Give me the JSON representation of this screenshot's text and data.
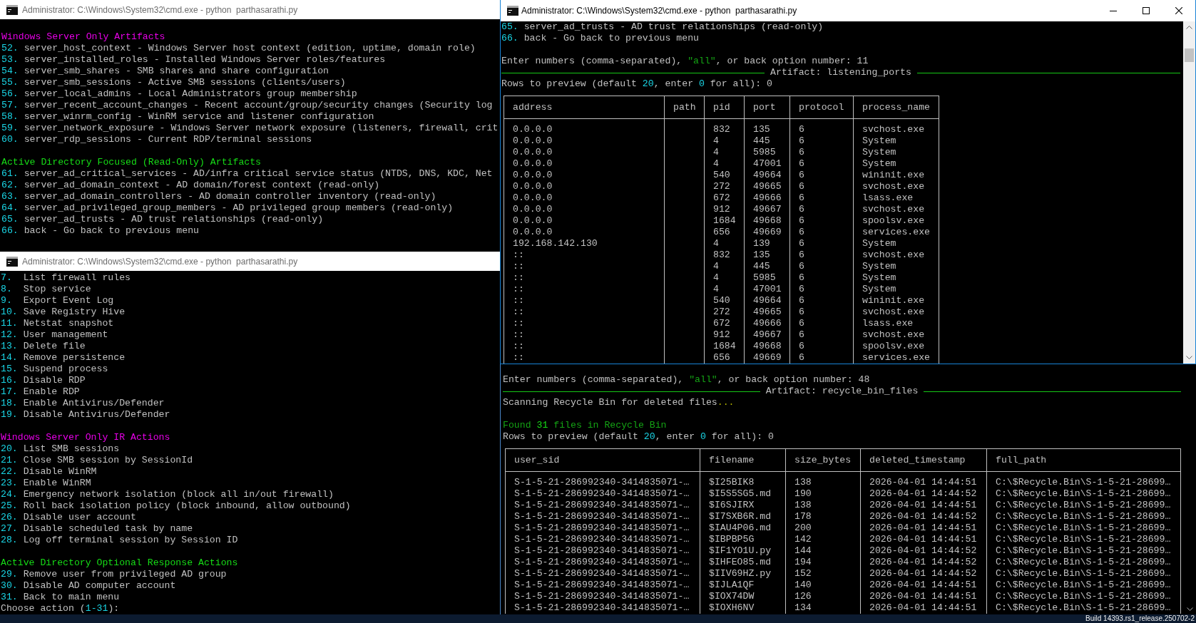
{
  "left_top_window": {
    "title": "Administrator: C:\\Windows\\System32\\cmd.exe - python  parthasarathi.py",
    "active": false,
    "sections": [
      {
        "heading": "Windows Server Only Artifacts",
        "color": "#e800e8",
        "items": [
          {
            "number": "52.",
            "text": "server_host_context - Windows Server host context (edition, uptime, domain role)"
          },
          {
            "number": "53.",
            "text": "server_installed_roles - Installed Windows Server roles/features"
          },
          {
            "number": "54.",
            "text": "server_smb_shares - SMB shares and share configuration"
          },
          {
            "number": "55.",
            "text": "server_smb_sessions - Active SMB sessions (clients/users)"
          },
          {
            "number": "56.",
            "text": "server_local_admins - Local Administrators group membership"
          },
          {
            "number": "57.",
            "text": "server_recent_account_changes - Recent account/group/security changes (Security log"
          },
          {
            "number": "58.",
            "text": "server_winrm_config - WinRM service and listener configuration"
          },
          {
            "number": "59.",
            "text": "server_network_exposure - Windows Server network exposure (listeners, firewall, crit"
          },
          {
            "number": "60.",
            "text": "server_rdp_sessions - Current RDP/terminal sessions"
          }
        ]
      },
      {
        "heading": "Active Directory Focused (Read-Only) Artifacts",
        "color": "#16dc16",
        "items": [
          {
            "number": "61.",
            "text": "server_ad_critical_services - AD/infra critical service status (NTDS, DNS, KDC, Net"
          },
          {
            "number": "62.",
            "text": "server_ad_domain_context - AD domain/forest context (read-only)"
          },
          {
            "number": "63.",
            "text": "server_ad_domain_controllers - AD domain controller inventory (read-only)"
          },
          {
            "number": "64.",
            "text": "server_ad_privileged_group_members - AD privileged group members (read-only)"
          },
          {
            "number": "65.",
            "text": "server_ad_trusts - AD trust relationships (read-only)"
          },
          {
            "number": "66.",
            "text": "back - Go back to previous menu"
          }
        ]
      }
    ]
  },
  "left_bottom_window": {
    "title": "Administrator: C:\\Windows\\System32\\cmd.exe - python  parthasarathi.py",
    "active": false,
    "sections": [
      {
        "items": [
          {
            "number": "7.",
            "text": "List firewall rules"
          },
          {
            "number": "8.",
            "text": "Stop service"
          },
          {
            "number": "9.",
            "text": "Export Event Log"
          },
          {
            "number": "10.",
            "text": "Save Registry Hive"
          },
          {
            "number": "11.",
            "text": "Netstat snapshot"
          },
          {
            "number": "12.",
            "text": "User management"
          },
          {
            "number": "13.",
            "text": "Delete file"
          },
          {
            "number": "14.",
            "text": "Remove persistence"
          },
          {
            "number": "15.",
            "text": "Suspend process"
          },
          {
            "number": "16.",
            "text": "Disable RDP"
          },
          {
            "number": "17.",
            "text": "Enable RDP"
          },
          {
            "number": "18.",
            "text": "Enable Antivirus/Defender"
          },
          {
            "number": "19.",
            "text": "Disable Antivirus/Defender"
          }
        ]
      },
      {
        "heading": "Windows Server Only IR Actions",
        "color": "#e800e8",
        "items": [
          {
            "number": "20.",
            "text": "List SMB sessions"
          },
          {
            "number": "21.",
            "text": "Close SMB session by SessionId"
          },
          {
            "number": "22.",
            "text": "Disable WinRM"
          },
          {
            "number": "23.",
            "text": "Enable WinRM"
          },
          {
            "number": "24.",
            "text": "Emergency network isolation (block all in/out firewall)"
          },
          {
            "number": "25.",
            "text": "Roll back isolation policy (block inbound, allow outbound)"
          },
          {
            "number": "26.",
            "text": "Disable user account"
          },
          {
            "number": "27.",
            "text": "Disable scheduled task by name"
          },
          {
            "number": "28.",
            "text": "Log off terminal session by Session ID"
          }
        ]
      },
      {
        "heading": "Active Directory Optional Response Actions",
        "color": "#16dc16",
        "items": [
          {
            "number": "29.",
            "text": "Remove user from privileged AD group"
          },
          {
            "number": "30.",
            "text": "Disable AD computer account"
          },
          {
            "number": "31.",
            "text": "Back to main menu"
          }
        ]
      }
    ],
    "prompt": [
      {
        "text": "Choose action (",
        "kind": "plain"
      },
      {
        "text": "1-31",
        "kind": "number"
      },
      {
        "text": "):",
        "kind": "plain"
      }
    ]
  },
  "right_top_window": {
    "title": "Administrator: C:\\Windows\\System32\\cmd.exe - python  parthasarathi.py",
    "active": true,
    "caption_buttons": [
      {
        "kind": "minimize"
      },
      {
        "kind": "maximize"
      },
      {
        "kind": "close"
      }
    ],
    "sections": [
      {
        "items": [
          {
            "number": "65.",
            "text": "server_ad_trusts - AD trust relationships (read-only)"
          },
          {
            "number": "66.",
            "text": "back - Go back to previous menu"
          }
        ]
      }
    ],
    "prompt": [
      {
        "text": "Enter numbers (comma-separated), ",
        "kind": "plain"
      },
      {
        "text": "\"all\"",
        "kind": "string"
      },
      {
        "text": ", or back option number: 11",
        "kind": "plain"
      }
    ],
    "artifact_rule": "Artifact: listening_ports",
    "rows_prompt": [
      {
        "text": "Rows to preview (default ",
        "kind": "plain"
      },
      {
        "text": "20",
        "kind": "number"
      },
      {
        "text": ", enter ",
        "kind": "plain"
      },
      {
        "text": "0",
        "kind": "number"
      },
      {
        "text": " for all): 0",
        "kind": "plain"
      }
    ],
    "table": {
      "columns": [
        "address",
        "path",
        "pid",
        "port",
        "protocol",
        "process_name"
      ],
      "rows": [
        [
          "0.0.0.0",
          null,
          "832",
          "135",
          "6",
          "svchost.exe"
        ],
        [
          "0.0.0.0",
          null,
          "4",
          "445",
          "6",
          "System"
        ],
        [
          "0.0.0.0",
          null,
          "4",
          "5985",
          "6",
          "System"
        ],
        [
          "0.0.0.0",
          null,
          "4",
          "47001",
          "6",
          "System"
        ],
        [
          "0.0.0.0",
          null,
          "540",
          "49664",
          "6",
          "wininit.exe"
        ],
        [
          "0.0.0.0",
          null,
          "272",
          "49665",
          "6",
          "svchost.exe"
        ],
        [
          "0.0.0.0",
          null,
          "672",
          "49666",
          "6",
          "lsass.exe"
        ],
        [
          "0.0.0.0",
          null,
          "912",
          "49667",
          "6",
          "svchost.exe"
        ],
        [
          "0.0.0.0",
          null,
          "1684",
          "49668",
          "6",
          "spoolsv.exe"
        ],
        [
          "0.0.0.0",
          null,
          "656",
          "49669",
          "6",
          "services.exe"
        ],
        [
          "192.168.142.130",
          null,
          "4",
          "139",
          "6",
          "System"
        ],
        [
          "::",
          null,
          "832",
          "135",
          "6",
          "svchost.exe"
        ],
        [
          "::",
          null,
          "4",
          "445",
          "6",
          "System"
        ],
        [
          "::",
          null,
          "4",
          "5985",
          "6",
          "System"
        ],
        [
          "::",
          null,
          "4",
          "47001",
          "6",
          "System"
        ],
        [
          "::",
          null,
          "540",
          "49664",
          "6",
          "wininit.exe"
        ],
        [
          "::",
          null,
          "272",
          "49665",
          "6",
          "svchost.exe"
        ],
        [
          "::",
          null,
          "672",
          "49666",
          "6",
          "lsass.exe"
        ],
        [
          "::",
          null,
          "912",
          "49667",
          "6",
          "svchost.exe"
        ],
        [
          "::",
          null,
          "1684",
          "49668",
          "6",
          "spoolsv.exe"
        ],
        [
          "::",
          null,
          "656",
          "49669",
          "6",
          "services.exe"
        ]
      ]
    }
  },
  "right_bottom_window": {
    "prompt": [
      {
        "text": "Enter numbers (comma-separated), ",
        "kind": "plain"
      },
      {
        "text": "\"all\"",
        "kind": "string"
      },
      {
        "text": ", or back option number: 48",
        "kind": "plain"
      }
    ],
    "artifact_rule": "Artifact: recycle_bin_files",
    "scan_status": [
      {
        "text": "Scanning Recycle Bin for deleted files",
        "kind": "plain"
      },
      {
        "text": "...",
        "kind": "ellipsis"
      }
    ],
    "result": [
      {
        "text": "Found ",
        "kind": "success"
      },
      {
        "text": "31",
        "kind": "success_number"
      },
      {
        "text": " files in Recycle Bin",
        "kind": "success"
      }
    ],
    "rows_prompt": [
      {
        "text": "Rows to preview (default ",
        "kind": "plain"
      },
      {
        "text": "20",
        "kind": "number"
      },
      {
        "text": ", enter ",
        "kind": "plain"
      },
      {
        "text": "0",
        "kind": "number"
      },
      {
        "text": " for all): 0",
        "kind": "plain"
      }
    ],
    "table": {
      "columns": [
        "user_sid",
        "filename",
        "size_bytes",
        "deleted_timestamp",
        "full_path"
      ],
      "rows": [
        [
          "S-1-5-21-286992340-3414835071-…",
          "$I25BIK8",
          "138",
          "2026-04-01 14:44:51",
          "C:\\$Recycle.Bin\\S-1-5-21-28699…"
        ],
        [
          "S-1-5-21-286992340-3414835071-…",
          "$I5S5SG5.md",
          "190",
          "2026-04-01 14:44:52",
          "C:\\$Recycle.Bin\\S-1-5-21-28699…"
        ],
        [
          "S-1-5-21-286992340-3414835071-…",
          "$I6SJIRX",
          "138",
          "2026-04-01 14:44:51",
          "C:\\$Recycle.Bin\\S-1-5-21-28699…"
        ],
        [
          "S-1-5-21-286992340-3414835071-…",
          "$I7SXB6R.md",
          "178",
          "2026-04-01 14:44:52",
          "C:\\$Recycle.Bin\\S-1-5-21-28699…"
        ],
        [
          "S-1-5-21-286992340-3414835071-…",
          "$IAU4P06.md",
          "200",
          "2026-04-01 14:44:51",
          "C:\\$Recycle.Bin\\S-1-5-21-28699…"
        ],
        [
          "S-1-5-21-286992340-3414835071-…",
          "$IBPBP5G",
          "142",
          "2026-04-01 14:44:51",
          "C:\\$Recycle.Bin\\S-1-5-21-28699…"
        ],
        [
          "S-1-5-21-286992340-3414835071-…",
          "$IF1YO1U.py",
          "144",
          "2026-04-01 14:44:52",
          "C:\\$Recycle.Bin\\S-1-5-21-28699…"
        ],
        [
          "S-1-5-21-286992340-3414835071-…",
          "$IHFEO85.md",
          "194",
          "2026-04-01 14:44:52",
          "C:\\$Recycle.Bin\\S-1-5-21-28699…"
        ],
        [
          "S-1-5-21-286992340-3414835071-…",
          "$IIV69HZ.py",
          "152",
          "2026-04-01 14:44:52",
          "C:\\$Recycle.Bin\\S-1-5-21-28699…"
        ],
        [
          "S-1-5-21-286992340-3414835071-…",
          "$IJLA1QF",
          "140",
          "2026-04-01 14:44:51",
          "C:\\$Recycle.Bin\\S-1-5-21-28699…"
        ],
        [
          "S-1-5-21-286992340-3414835071-…",
          "$IOX74DW",
          "126",
          "2026-04-01 14:44:51",
          "C:\\$Recycle.Bin\\S-1-5-21-28699…"
        ],
        [
          "S-1-5-21-286992340-3414835071-…",
          "$IOXH6NV",
          "134",
          "2026-04-01 14:44:51",
          "C:\\$Recycle.Bin\\S-1-5-21-28699…"
        ]
      ]
    }
  },
  "desktop": {
    "build_label": "Build 14393.rs1_release.250702-2"
  }
}
